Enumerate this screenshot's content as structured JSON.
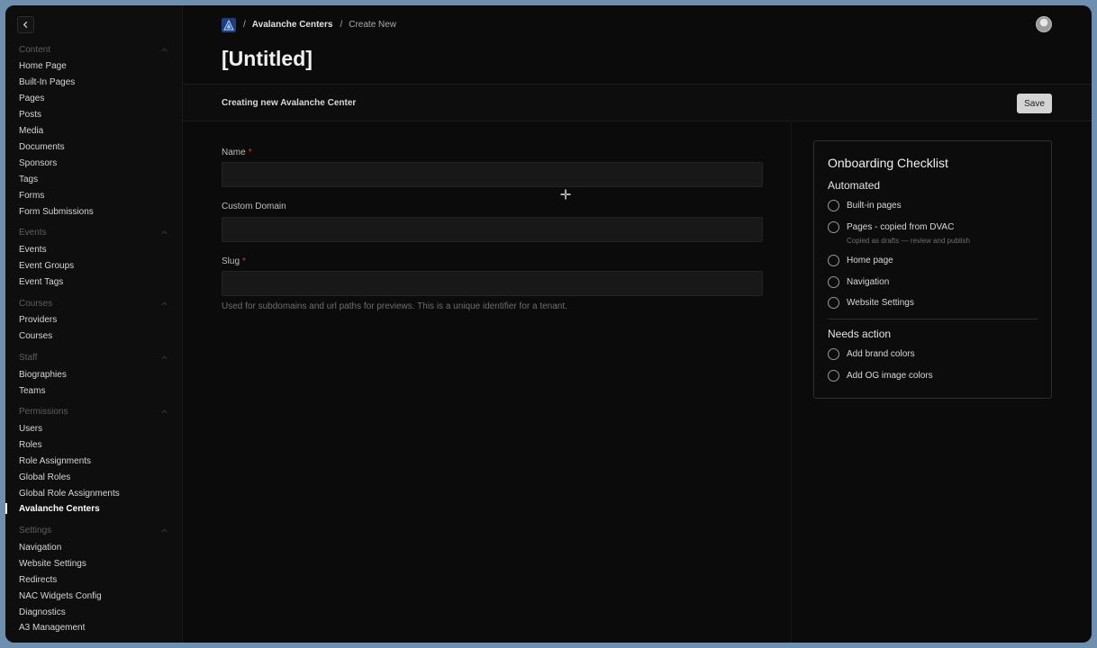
{
  "sidebar": {
    "groups": [
      {
        "title": "Content",
        "items": [
          "Home Page",
          "Built-In Pages",
          "Pages",
          "Posts",
          "Media",
          "Documents",
          "Sponsors",
          "Tags",
          "Forms",
          "Form Submissions"
        ]
      },
      {
        "title": "Events",
        "items": [
          "Events",
          "Event Groups",
          "Event Tags"
        ]
      },
      {
        "title": "Courses",
        "items": [
          "Providers",
          "Courses"
        ]
      },
      {
        "title": "Staff",
        "items": [
          "Biographies",
          "Teams"
        ]
      },
      {
        "title": "Permissions",
        "items": [
          "Users",
          "Roles",
          "Role Assignments",
          "Global Roles",
          "Global Role Assignments",
          "Avalanche Centers"
        ]
      },
      {
        "title": "Settings",
        "items": [
          "Navigation",
          "Website Settings",
          "Redirects",
          "NAC Widgets Config",
          "Diagnostics",
          "A3 Management"
        ]
      }
    ],
    "active_item": "Avalanche Centers"
  },
  "breadcrumb": {
    "separator": "/",
    "parent": "Avalanche Centers",
    "current": "Create New"
  },
  "page_title": "[Untitled]",
  "doc_bar": {
    "label": "Creating new Avalanche Center",
    "save_label": "Save"
  },
  "form": {
    "name_label": "Name",
    "name_value": "",
    "domain_label": "Custom Domain",
    "domain_value": "",
    "slug_label": "Slug",
    "slug_value": "",
    "required_marker": "*",
    "slug_help": "Used for subdomains and url paths for previews. This is a unique identifier for a tenant."
  },
  "checklist": {
    "title": "Onboarding Checklist",
    "automated_title": "Automated",
    "automated": [
      {
        "label": "Built-in pages"
      },
      {
        "label": "Pages - copied from DVAC",
        "sub": "Copied as drafts — review and publish"
      },
      {
        "label": "Home page"
      },
      {
        "label": "Navigation"
      },
      {
        "label": "Website Settings"
      }
    ],
    "needs_action_title": "Needs action",
    "needs_action": [
      {
        "label": "Add brand colors"
      },
      {
        "label": "Add OG image colors"
      }
    ]
  },
  "icons": {
    "collapse": "chevron-left-icon",
    "group_toggle": "chevron-up-icon",
    "logo": "avalanche-logo-icon",
    "avatar": "user-avatar",
    "cursor": "move-cursor-icon"
  },
  "colors": {
    "background": "#0b0b0b",
    "required": "#c2403d",
    "save_button": "#d4d4d4",
    "logo_bg": "#1f3f7a"
  }
}
